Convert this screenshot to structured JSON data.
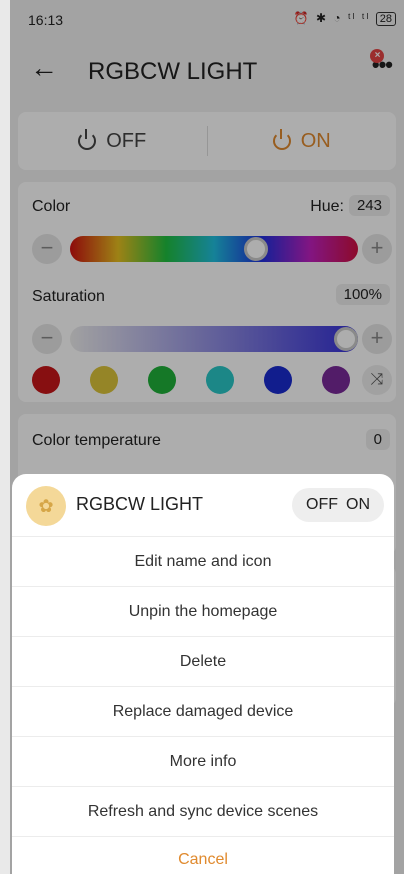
{
  "status": {
    "time": "16:13",
    "icons": "⏰ ✱ ◔ ᵗˡ ᵗˡ",
    "battery": "28"
  },
  "header": {
    "title": "RGBCW LIGHT",
    "back_icon": "arrow-left-icon",
    "more_icon": "more-icon",
    "badge": "×"
  },
  "power": {
    "off_label": "OFF",
    "on_label": "ON",
    "active_color": "#e08a2e"
  },
  "color": {
    "label": "Color",
    "hue_label": "Hue:",
    "hue_value": "243",
    "saturation_label": "Saturation",
    "saturation_value": "100%",
    "hue_fraction": 0.66,
    "saturation_fraction": 1.0,
    "swatches": [
      "#c8171a",
      "#dcc53a",
      "#1fb23a",
      "#2ac8c8",
      "#1a2bd0",
      "#7a2a9a"
    ]
  },
  "temperature": {
    "label": "Color temperature",
    "value": "0"
  },
  "sheet": {
    "device_name": "RGBCW LIGHT",
    "toggle_off": "OFF",
    "toggle_on": "ON",
    "items": [
      "Edit name and icon",
      "Unpin the homepage",
      "Delete",
      "Replace damaged device",
      "More info",
      "Refresh and sync device scenes"
    ],
    "cancel": "Cancel"
  }
}
